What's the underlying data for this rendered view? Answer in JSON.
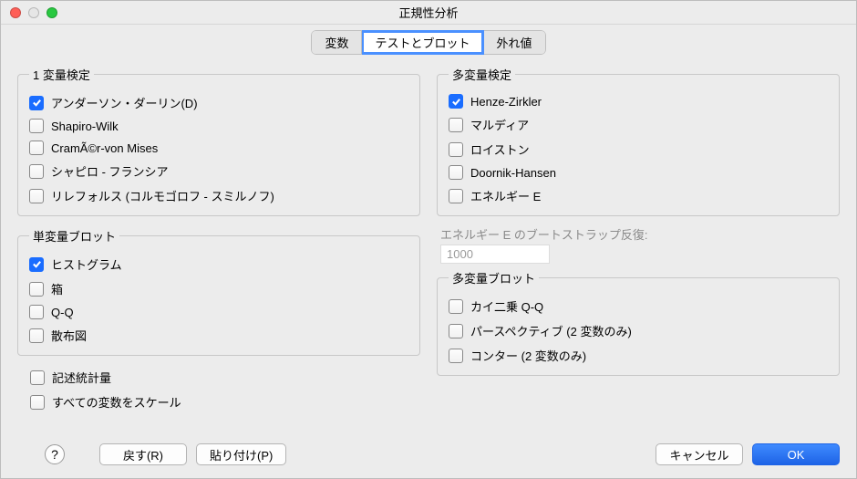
{
  "window": {
    "title": "正規性分析"
  },
  "tabs": {
    "variables": "変数",
    "tests_plots": "テストとブロット",
    "outliers": "外れ値"
  },
  "groups": {
    "univariate_tests": {
      "legend": "1 変量検定",
      "items": {
        "anderson_darling": {
          "label": "アンダーソン・ダーリン(D)",
          "checked": true
        },
        "shapiro_wilk": {
          "label": "Shapiro-Wilk",
          "checked": false
        },
        "cramer_von_mises": {
          "label": "CramÃ©r-von Mises",
          "checked": false
        },
        "shapiro_francia": {
          "label": "シャピロ - フランシア",
          "checked": false
        },
        "lilliefors": {
          "label": "リレフォルス (コルモゴロフ - スミルノフ)",
          "checked": false
        }
      }
    },
    "univariate_plots": {
      "legend": "単変量ブロット",
      "items": {
        "histogram": {
          "label": "ヒストグラム",
          "checked": true
        },
        "box": {
          "label": "箱",
          "checked": false
        },
        "qq": {
          "label": "Q-Q",
          "checked": false
        },
        "scatter": {
          "label": "散布図",
          "checked": false
        }
      }
    },
    "multivariate_tests": {
      "legend": "多変量検定",
      "items": {
        "henze_zirkler": {
          "label": "Henze-Zirkler",
          "checked": true
        },
        "mardia": {
          "label": "マルディア",
          "checked": false
        },
        "royston": {
          "label": "ロイストン",
          "checked": false
        },
        "doornik_hansen": {
          "label": "Doornik-Hansen",
          "checked": false
        },
        "energy_e": {
          "label": "エネルギー E",
          "checked": false
        }
      }
    },
    "multivariate_plots": {
      "legend": "多変量ブロット",
      "items": {
        "chisq_qq": {
          "label": "カイ二乗 Q-Q",
          "checked": false
        },
        "perspective": {
          "label": "パースペクティブ (2 変数のみ)",
          "checked": false
        },
        "contour": {
          "label": "コンター (2 変数のみ)",
          "checked": false
        }
      }
    }
  },
  "energy_field": {
    "label": "エネルギー E のブートストラップ反復:",
    "value": "1000"
  },
  "loose": {
    "descriptives": {
      "label": "記述統計量",
      "checked": false
    },
    "scale_all": {
      "label": "すべての変数をスケール",
      "checked": false
    }
  },
  "footer": {
    "help": "?",
    "reset": "戻す(R)",
    "paste": "貼り付け(P)",
    "cancel": "キャンセル",
    "ok": "OK"
  }
}
